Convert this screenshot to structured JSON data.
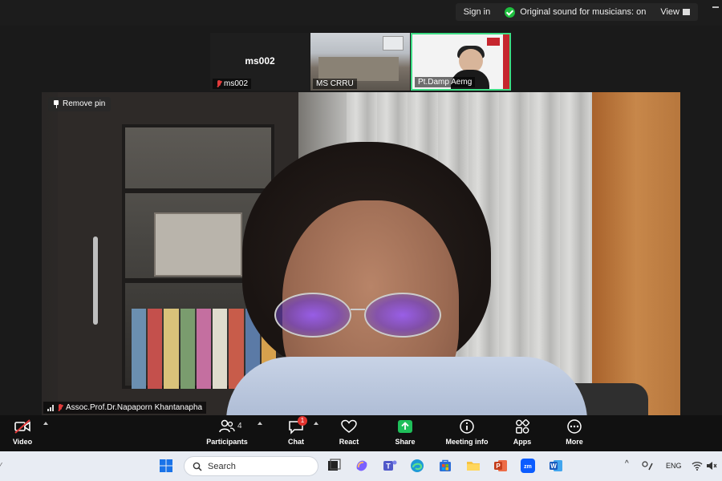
{
  "topbar": {
    "sign_in": "Sign in",
    "original_sound": "Original sound for musicians: on",
    "view": "View"
  },
  "thumbnails": [
    {
      "name": "ms002",
      "center_label": "ms002",
      "muted": true
    },
    {
      "name": "MS CRRU",
      "muted": false
    },
    {
      "name": "Pt.Damp Aemg",
      "muted": false,
      "active_speaker": true
    }
  ],
  "main_video": {
    "remove_pin": "Remove pin",
    "participant_name": "Assoc.Prof.Dr.Napaporn Khantanapha",
    "muted": true
  },
  "controls": {
    "video": "Video",
    "participants": "Participants",
    "participants_count": "4",
    "chat": "Chat",
    "chat_badge": "1",
    "react": "React",
    "share": "Share",
    "meeting_info": "Meeting info",
    "apps": "Apps",
    "more": "More"
  },
  "taskbar": {
    "search_placeholder": "Search",
    "language": "ENG"
  },
  "colors": {
    "share_green": "#1fbf5a",
    "mute_red": "#e23b3b",
    "active_border": "#3ddc84"
  }
}
